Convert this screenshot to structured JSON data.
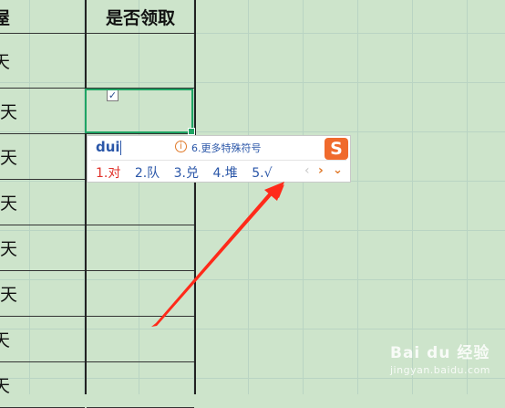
{
  "sheet": {
    "header_left": "屋",
    "header": "是否领取",
    "rows_left": [
      "天",
      "天",
      "天",
      "天",
      "天",
      "天",
      "天",
      "天"
    ]
  },
  "ime": {
    "pinyin": "dui",
    "hint": "6.更多特殊符号",
    "logo": "S",
    "candidates": [
      "1.对",
      "2.队",
      "3.兑",
      "4.堆",
      "5.√"
    ],
    "prev": "‹",
    "next": "›",
    "more": "⌄"
  },
  "watermark": {
    "brand": "Bai du 经验",
    "site": "jingyan.baidu.com"
  },
  "colors": {
    "arrow": "#ff2a1a",
    "selection": "#1fa463",
    "background": "#cde4cb"
  }
}
